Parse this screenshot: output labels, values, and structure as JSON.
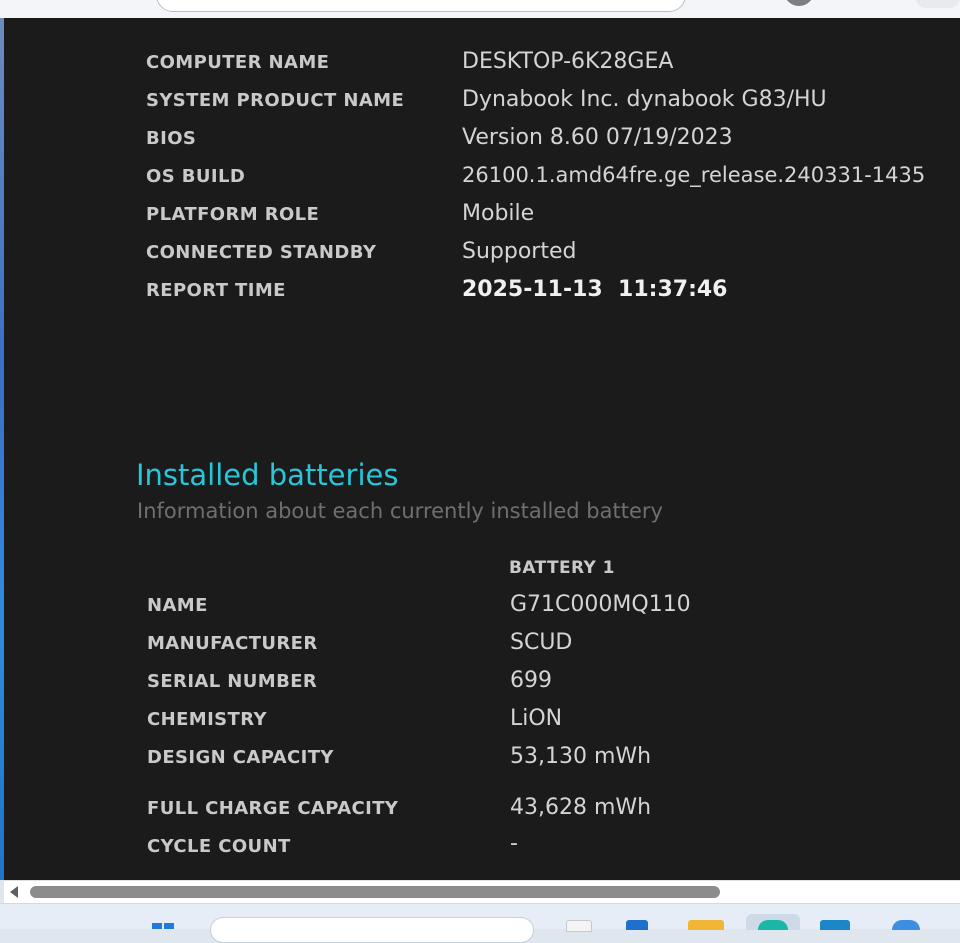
{
  "system_info": {
    "rows": [
      {
        "label": "COMPUTER NAME",
        "value": "DESKTOP-6K28GEA"
      },
      {
        "label": "SYSTEM PRODUCT NAME",
        "value": "Dynabook Inc. dynabook G83/HU"
      },
      {
        "label": "BIOS",
        "value": "Version 8.60 07/19/2023"
      },
      {
        "label": "OS BUILD",
        "value": "26100.1.amd64fre.ge_release.240331-1435"
      },
      {
        "label": "PLATFORM ROLE",
        "value": "Mobile"
      },
      {
        "label": "CONNECTED STANDBY",
        "value": "Supported"
      },
      {
        "label": "REPORT TIME",
        "value": "2025-11-13  11:37:46"
      }
    ]
  },
  "installed_batteries": {
    "title": "Installed batteries",
    "subtitle": "Information about each currently installed battery",
    "column_header": "BATTERY 1",
    "rows": [
      {
        "label": "NAME",
        "value": "G71C000MQ110"
      },
      {
        "label": "MANUFACTURER",
        "value": "SCUD"
      },
      {
        "label": "SERIAL NUMBER",
        "value": "699"
      },
      {
        "label": "CHEMISTRY",
        "value": "LiON"
      },
      {
        "label": "DESIGN CAPACITY",
        "value": "53,130 mWh"
      },
      {
        "label": "FULL CHARGE CAPACITY",
        "value": "43,628 mWh"
      },
      {
        "label": "CYCLE COUNT",
        "value": "-"
      }
    ]
  },
  "colors": {
    "report_background": "#1b1b1b",
    "section_title": "#27c6d8",
    "label_text": "#c9c9c9",
    "value_text": "#d4d4d4"
  },
  "icons": [
    "scroll-left-arrow-icon",
    "windows-start-icon"
  ]
}
